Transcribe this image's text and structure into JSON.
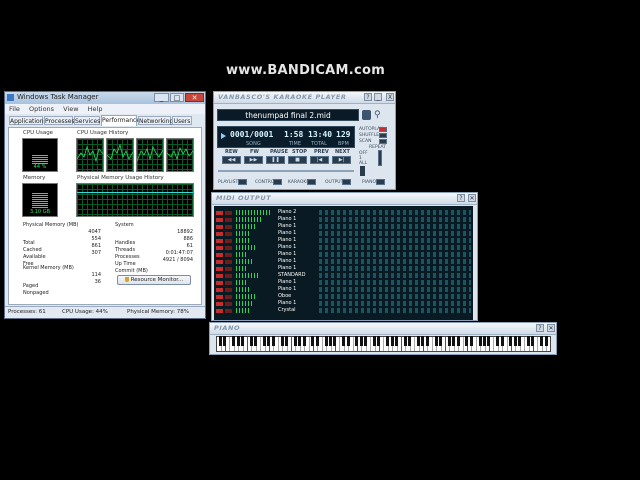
{
  "watermark": "www.BANDICAM.com",
  "task_manager": {
    "title": "Windows Task Manager",
    "menu": [
      "File",
      "Options",
      "View",
      "Help"
    ],
    "tabs": [
      "Applications",
      "Processes",
      "Services",
      "Performance",
      "Networking",
      "Users"
    ],
    "active_tab": "Performance",
    "cpu_usage_label": "CPU Usage",
    "cpu_usage_value": "44 %",
    "cpu_usage_fraction": 0.44,
    "cpu_history_label": "CPU Usage History",
    "memory_label": "Memory",
    "memory_value": "3.10 GB",
    "memory_fraction": 0.78,
    "mem_history_label": "Physical Memory Usage History",
    "physical_memory": {
      "title": "Physical Memory (MB)",
      "rows": [
        {
          "label": "Total",
          "value": "4047"
        },
        {
          "label": "Cached",
          "value": "554"
        },
        {
          "label": "Available",
          "value": "861"
        },
        {
          "label": "Free",
          "value": "307"
        }
      ]
    },
    "system": {
      "title": "System",
      "rows": [
        {
          "label": "Handles",
          "value": "18892"
        },
        {
          "label": "Threads",
          "value": "886"
        },
        {
          "label": "Processes",
          "value": "61"
        },
        {
          "label": "Up Time",
          "value": "0:01:47:07"
        },
        {
          "label": "Commit (MB)",
          "value": "4921 / 8094"
        }
      ]
    },
    "kernel_memory": {
      "title": "Kernel Memory (MB)",
      "rows": [
        {
          "label": "Paged",
          "value": "114"
        },
        {
          "label": "Nonpaged",
          "value": "36"
        }
      ]
    },
    "resource_monitor_button": "Resource Monitor...",
    "status": {
      "processes": "Processes: 61",
      "cpu": "CPU Usage: 44%",
      "memory": "Physical Memory: 78%"
    }
  },
  "karaoke": {
    "title": "VANBASCO'S KARAOKE PLAYER",
    "song": "thenumpad final 2.mid",
    "lcd": [
      {
        "value": "0001/0001",
        "label": "SONG"
      },
      {
        "value": "1:58",
        "label": "TIME"
      },
      {
        "value": "13:40",
        "label": "TOTAL"
      },
      {
        "value": "129",
        "label": "BPM"
      }
    ],
    "side_labels": [
      "AUTOPLAY",
      "SHUFFLE",
      "SCAN"
    ],
    "repeat_label": "REPEAT",
    "repeat_options": [
      "OFF",
      "1",
      "ALL"
    ],
    "transport": [
      "REW",
      "FW",
      "PAUSE",
      "STOP",
      "PREV",
      "NEXT"
    ],
    "bottom": [
      "PLAYLIST",
      "CONTROL",
      "KARAOKE",
      "OUTPUT",
      "PIANO"
    ],
    "title_buttons": [
      "?",
      "_",
      "X"
    ]
  },
  "midi_output": {
    "title": "MIDI OUTPUT",
    "instruments": [
      "Piano 2",
      "Piano 1",
      "Piano 1",
      "Piano 1",
      "Piano 1",
      "Piano 1",
      "Piano 1",
      "Piano 1",
      "Piano 1",
      "STANDARD",
      "Piano 1",
      "Piano 1",
      "Oboe",
      "Piano 1",
      "Crystal"
    ],
    "levels": [
      0.95,
      0.7,
      0.55,
      0.4,
      0.35,
      0.5,
      0.3,
      0.45,
      0.25,
      0.6,
      0.3,
      0.4,
      0.5,
      0.45,
      0.35
    ]
  },
  "piano": {
    "title": "PIANO"
  }
}
